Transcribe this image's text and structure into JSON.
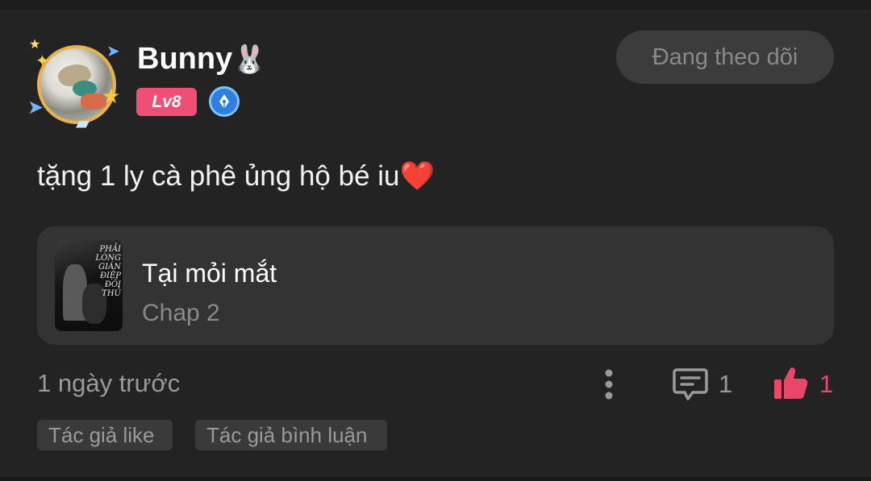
{
  "post": {
    "username": "Bunny",
    "username_emoji": "🐰",
    "level_badge": "Lv8",
    "follow_button_label": "Đang theo dõi",
    "comment_text": "tặng 1 ly cà phê ủng hộ bé iu",
    "comment_emoji": "❤️"
  },
  "story_card": {
    "title": "Tại mỏi mắt",
    "chapter": "Chap 2",
    "cover_text": "PHẢI LÒNG GIÁN ĐIỆP ĐỐI THỦ"
  },
  "footer": {
    "time": "1 ngày trước",
    "comment_count": "1",
    "like_count": "1"
  },
  "tags": [
    {
      "label": "Tác giả like"
    },
    {
      "label": "Tác giả bình luận"
    }
  ],
  "colors": {
    "background": "#232323",
    "level_badge": "#ef4f74",
    "like_accent": "#e8476a",
    "verified_badge": "#2f7fe0"
  },
  "icons": [
    "avatar-frame",
    "pen-badge-icon",
    "more-vertical-icon",
    "comment-icon",
    "thumbs-up-icon"
  ]
}
